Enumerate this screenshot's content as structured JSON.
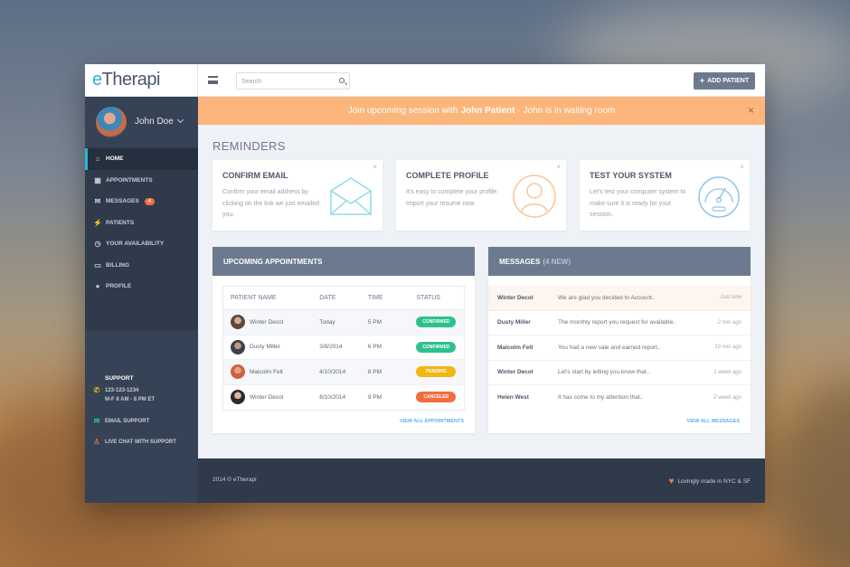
{
  "app": {
    "logo_prefix": "e",
    "logo_rest": "Therapi"
  },
  "topbar": {
    "search_placeholder": "Search",
    "add_patient_label": "ADD PATIENT"
  },
  "user": {
    "name": "John Doe"
  },
  "nav": [
    {
      "label": "HOME",
      "icon": "home-icon",
      "active": true
    },
    {
      "label": "APPOINTMENTS",
      "icon": "calendar-icon"
    },
    {
      "label": "MESSAGES",
      "icon": "envelope-icon",
      "badge": "4"
    },
    {
      "label": "PATIENTS",
      "icon": "bolt-icon"
    },
    {
      "label": "YOUR AVAILABILITY",
      "icon": "clock-icon"
    },
    {
      "label": "BILLING",
      "icon": "credit-card-icon"
    },
    {
      "label": "PROFILE",
      "icon": "user-icon"
    }
  ],
  "support": {
    "title": "SUPPORT",
    "phone": "123-123-1234",
    "hours": "M-F 8 AM - 8 PM  ET",
    "email_label": "EMAIL SUPPORT",
    "chat_label": "LIVE CHAT WITH SUPPORT"
  },
  "banner": {
    "prefix": "Join upcoming session with",
    "patient": "John Patient",
    "suffix": "- John is in waiting room",
    "close": "×"
  },
  "reminders": {
    "title": "REMINDERS",
    "cards": [
      {
        "title": "CONFIRM EMAIL",
        "text": "Confirm your email address by clicking on the link we just emailed you.",
        "icon": "envelope-icon"
      },
      {
        "title": "COMPLETE PROFILE",
        "text": "It's easy to complete your profile. Import your resume now.",
        "icon": "user-icon"
      },
      {
        "title": "TEST YOUR SYSTEM",
        "text": "Let's test your computer system to make sure it is ready for your session.",
        "icon": "gauge-icon"
      }
    ]
  },
  "appointments": {
    "title": "UPCOMING APPOINTMENTS",
    "columns": [
      "PATIENT NAME",
      "DATE",
      "TIME",
      "STATUS"
    ],
    "rows": [
      {
        "name": "Winter Decol",
        "date": "Today",
        "time": "5 PM",
        "status": "CONFIRMED"
      },
      {
        "name": "Dusty Miller",
        "date": "3/8/2014",
        "time": "6 PM",
        "status": "CONFIRMED"
      },
      {
        "name": "Malcolm Felt",
        "date": "4/10/2014",
        "time": "8 PM",
        "status": "PENDING"
      },
      {
        "name": "Winter Decol",
        "date": "8/10/2014",
        "time": "9 PM",
        "status": "CANCELED"
      }
    ],
    "view_all": "VIEW ALL APPOINTMENTS"
  },
  "messages": {
    "title": "MESSAGES",
    "count_label": "(4 NEW)",
    "rows": [
      {
        "from": "Winter Decol",
        "text": "We are glad you decided to Account..",
        "time": "Just now"
      },
      {
        "from": "Dusty Miller",
        "text": "The monthly report you request for available..",
        "time": "2 min ago"
      },
      {
        "from": "Malcolm Felt",
        "text": "You had a new sale and earned report..",
        "time": "10 min ago"
      },
      {
        "from": "Winter Decol",
        "text": "Let's start by letting you know that..",
        "time": "1 week ago"
      },
      {
        "from": "Helen West",
        "text": "It has come to my attention that..",
        "time": "2 week ago"
      }
    ],
    "view_all": "VIEW ALL MESSAGES"
  },
  "footer": {
    "copyright": "2014 © eTherapi",
    "made": "Lovingly made in NYC & SF"
  },
  "colors": {
    "accent": "#28b5d6",
    "banner": "#fcb57a",
    "confirmed": "#2fc18c",
    "pending": "#f2b615",
    "canceled": "#f26d3d"
  }
}
